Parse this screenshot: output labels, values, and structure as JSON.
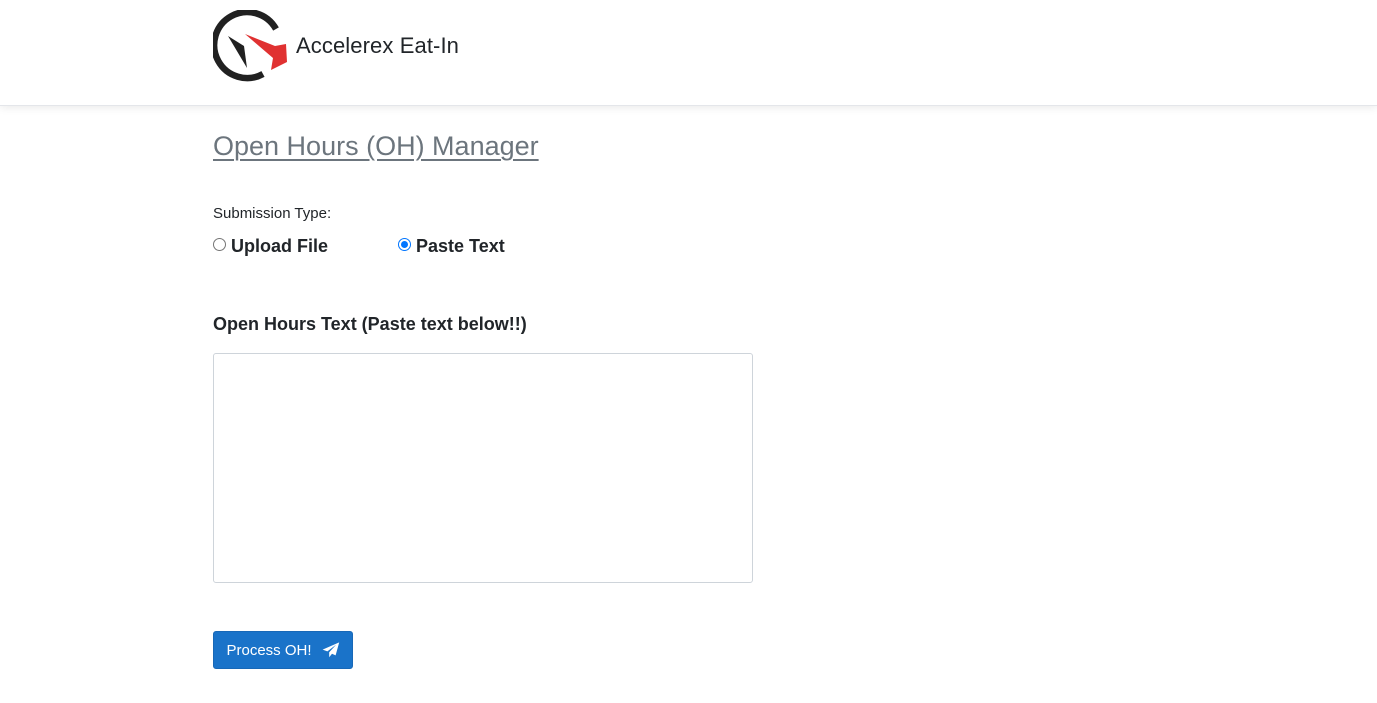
{
  "header": {
    "brand_name": "Accelerex Eat-In",
    "logo_icon": "accelerex-logo-icon"
  },
  "page": {
    "title": "Open Hours (OH) Manager"
  },
  "form": {
    "submission_type_label": "Submission Type:",
    "options": [
      {
        "label": "Upload File",
        "selected": false
      },
      {
        "label": "Paste Text",
        "selected": true
      }
    ],
    "text_label": "Open Hours Text (Paste text below!!)",
    "text_value": "",
    "submit_label": "Process OH!",
    "submit_icon": "paper-plane-icon"
  },
  "colors": {
    "primary": "#1a73c9",
    "title_gray": "#6c757d",
    "logo_red": "#e03131",
    "logo_dark": "#212121",
    "radio_blue": "#0075ff"
  }
}
